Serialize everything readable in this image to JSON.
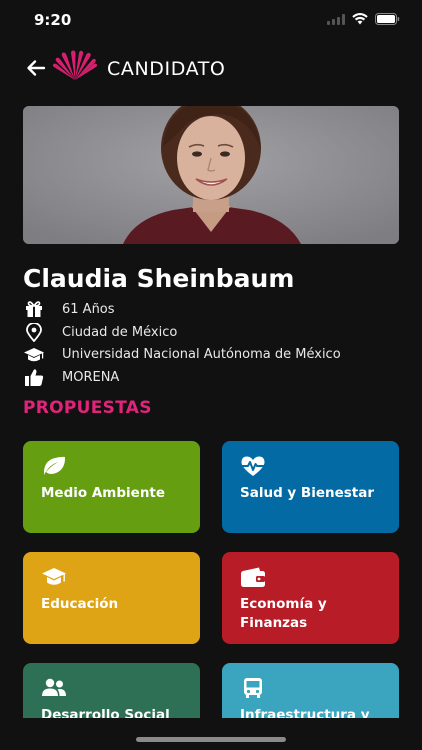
{
  "status_bar": {
    "time": "9:20"
  },
  "header": {
    "title": "CANDIDATO",
    "back_icon": "arrow-left-icon",
    "logo": "shell-logo"
  },
  "candidate": {
    "name": "Claudia Sheinbaum",
    "photo": "candidate-portrait",
    "info": [
      {
        "icon": "gift-icon",
        "text": "61 Años"
      },
      {
        "icon": "location-pin-icon",
        "text": "Ciudad de México"
      },
      {
        "icon": "graduation-cap-icon",
        "text": "Universidad Nacional Autónoma de México"
      },
      {
        "icon": "thumbs-up-icon",
        "text": "MORENA"
      }
    ]
  },
  "proposals": {
    "title": "PROPUESTAS",
    "items": [
      {
        "label": "Medio Ambiente",
        "icon": "leaf-icon",
        "color": "#669e12"
      },
      {
        "label": "Salud y Bienestar",
        "icon": "heartbeat-icon",
        "color": "#046aa4"
      },
      {
        "label": "Educación",
        "icon": "graduation-cap-icon",
        "color": "#dea416"
      },
      {
        "label": "Economía y Finanzas",
        "icon": "wallet-icon",
        "color": "#b71c27"
      },
      {
        "label": "Desarrollo Social",
        "icon": "users-icon",
        "color": "#2e7056"
      },
      {
        "label": "Infraestructura y",
        "icon": "bus-icon",
        "color": "#3ba4bf"
      }
    ]
  },
  "colors": {
    "background": "#111111",
    "accent": "#e0247a"
  }
}
